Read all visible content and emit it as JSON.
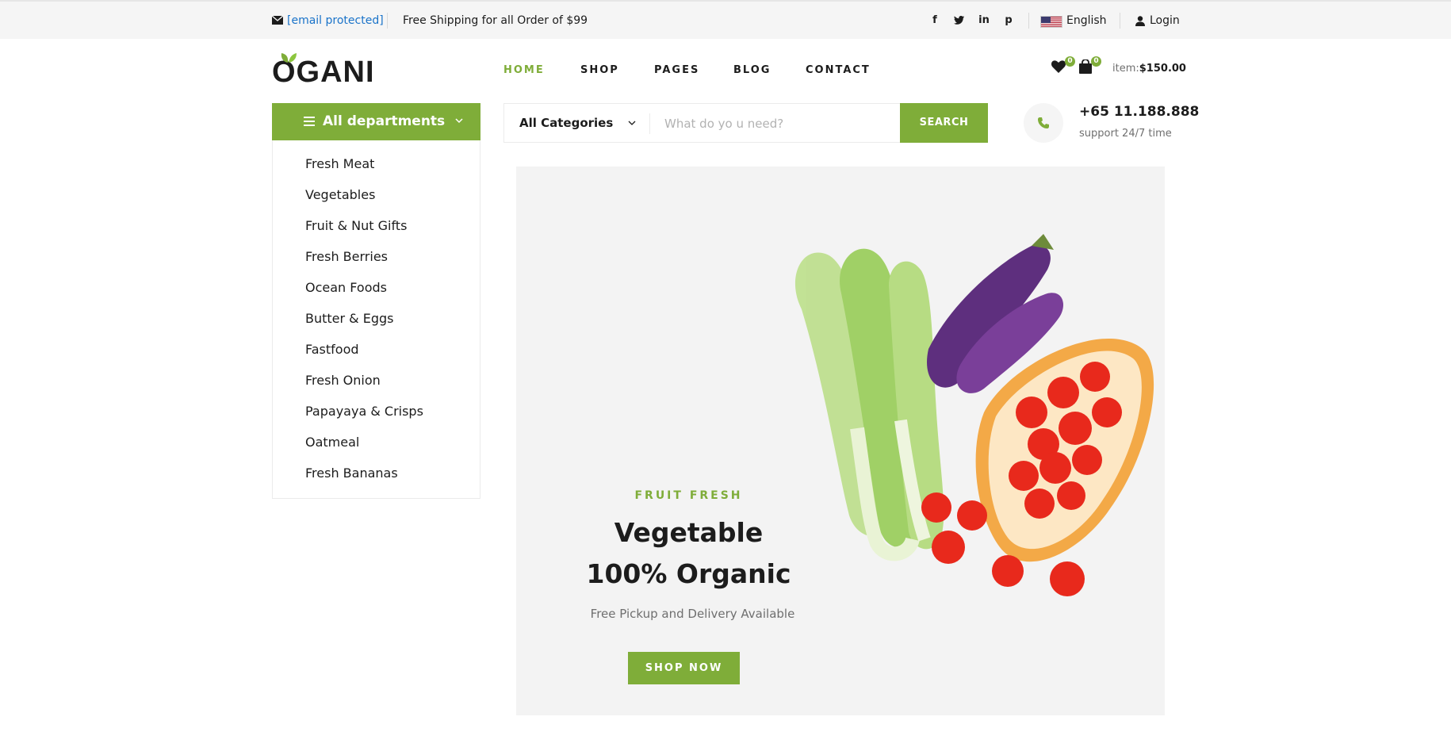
{
  "topbar": {
    "email": "[email protected]",
    "shipping": "Free Shipping for all Order of $99",
    "language": "English",
    "login": "Login"
  },
  "header": {
    "logo": "OGANI",
    "nav": [
      "HOME",
      "SHOP",
      "PAGES",
      "BLOG",
      "CONTACT"
    ],
    "wishlist_count": "0",
    "cart_count": "0",
    "cart_label": "item:",
    "cart_total": "$150.00"
  },
  "departments": {
    "title": "All departments",
    "items": [
      "Fresh Meat",
      "Vegetables",
      "Fruit & Nut Gifts",
      "Fresh Berries",
      "Ocean Foods",
      "Butter & Eggs",
      "Fastfood",
      "Fresh Onion",
      "Papayaya & Crisps",
      "Oatmeal",
      "Fresh Bananas"
    ]
  },
  "search": {
    "category": "All Categories",
    "placeholder": "What do yo u need?",
    "button": "SEARCH"
  },
  "contact": {
    "phone": "+65 11.188.888",
    "support": "support 24/7 time"
  },
  "hero": {
    "tag": "FRUIT FRESH",
    "title_line1": "Vegetable",
    "title_line2": "100% Organic",
    "subtitle": "Free Pickup and Delivery Available",
    "button": "SHOP NOW"
  },
  "colors": {
    "accent": "#7fad39",
    "text": "#1c1c1c",
    "muted": "#6f6f6f",
    "link": "#1a73c9"
  }
}
